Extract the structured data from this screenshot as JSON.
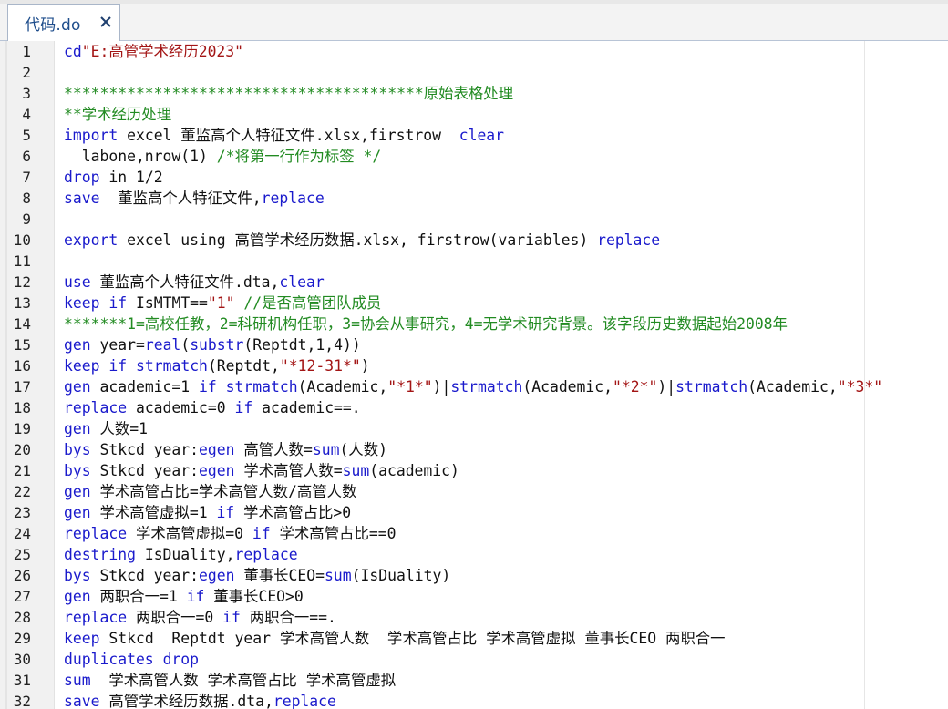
{
  "tab": {
    "title": "代码.do",
    "close_symbol": "×"
  },
  "colors": {
    "keyword": "#1a1acc",
    "string": "#a31515",
    "comment": "#228b22",
    "plain": "#111111",
    "tab_text": "#1f4e8c"
  },
  "lines": [
    {
      "n": "1",
      "tokens": [
        {
          "c": "kw",
          "t": "cd"
        },
        {
          "c": "str",
          "t": "\"E:高管学术经历2023\""
        }
      ]
    },
    {
      "n": "2",
      "tokens": []
    },
    {
      "n": "3",
      "tokens": [
        {
          "c": "cmt",
          "t": "****************************************原始表格处理"
        }
      ]
    },
    {
      "n": "4",
      "tokens": [
        {
          "c": "cmt",
          "t": "**学术经历处理"
        }
      ]
    },
    {
      "n": "5",
      "tokens": [
        {
          "c": "kw",
          "t": "import"
        },
        {
          "c": "plain",
          "t": " excel 董监高个人特征文件.xlsx,firstrow  "
        },
        {
          "c": "kw",
          "t": "clear"
        }
      ]
    },
    {
      "n": "6",
      "tokens": [
        {
          "c": "plain",
          "t": "  labone,nrow(1) "
        },
        {
          "c": "cmt",
          "t": "/*将第一行作为标签 */"
        }
      ]
    },
    {
      "n": "7",
      "tokens": [
        {
          "c": "kw",
          "t": "drop"
        },
        {
          "c": "plain",
          "t": " in 1/2"
        }
      ]
    },
    {
      "n": "8",
      "tokens": [
        {
          "c": "kw",
          "t": "save"
        },
        {
          "c": "plain",
          "t": "  董监高个人特征文件,"
        },
        {
          "c": "kw",
          "t": "replace"
        }
      ]
    },
    {
      "n": "9",
      "tokens": []
    },
    {
      "n": "10",
      "tokens": [
        {
          "c": "kw",
          "t": "export"
        },
        {
          "c": "plain",
          "t": " excel using 高管学术经历数据.xlsx, firstrow(variables) "
        },
        {
          "c": "kw",
          "t": "replace"
        }
      ]
    },
    {
      "n": "11",
      "tokens": []
    },
    {
      "n": "12",
      "tokens": [
        {
          "c": "kw",
          "t": "use"
        },
        {
          "c": "plain",
          "t": " 董监高个人特征文件.dta,"
        },
        {
          "c": "kw",
          "t": "clear"
        }
      ]
    },
    {
      "n": "13",
      "tokens": [
        {
          "c": "kw",
          "t": "keep"
        },
        {
          "c": "plain",
          "t": " "
        },
        {
          "c": "kw",
          "t": "if"
        },
        {
          "c": "plain",
          "t": " IsMTMT=="
        },
        {
          "c": "str",
          "t": "\"1\""
        },
        {
          "c": "plain",
          "t": " "
        },
        {
          "c": "cmt",
          "t": "//是否高管团队成员"
        }
      ]
    },
    {
      "n": "14",
      "tokens": [
        {
          "c": "cmt",
          "t": "*******1=高校任教，2=科研机构任职，3=协会从事研究，4=无学术研究背景。该字段历史数据起始2008年"
        }
      ]
    },
    {
      "n": "15",
      "tokens": [
        {
          "c": "kw",
          "t": "gen"
        },
        {
          "c": "plain",
          "t": " year="
        },
        {
          "c": "kw",
          "t": "real"
        },
        {
          "c": "plain",
          "t": "("
        },
        {
          "c": "kw",
          "t": "substr"
        },
        {
          "c": "plain",
          "t": "(Reptdt,1,4))"
        }
      ]
    },
    {
      "n": "16",
      "tokens": [
        {
          "c": "kw",
          "t": "keep"
        },
        {
          "c": "plain",
          "t": " "
        },
        {
          "c": "kw",
          "t": "if"
        },
        {
          "c": "plain",
          "t": " "
        },
        {
          "c": "kw",
          "t": "strmatch"
        },
        {
          "c": "plain",
          "t": "(Reptdt,"
        },
        {
          "c": "str",
          "t": "\"*12-31*\""
        },
        {
          "c": "plain",
          "t": ")"
        }
      ]
    },
    {
      "n": "17",
      "tokens": [
        {
          "c": "kw",
          "t": "gen"
        },
        {
          "c": "plain",
          "t": " academic=1 "
        },
        {
          "c": "kw",
          "t": "if"
        },
        {
          "c": "plain",
          "t": " "
        },
        {
          "c": "kw",
          "t": "strmatch"
        },
        {
          "c": "plain",
          "t": "(Academic,"
        },
        {
          "c": "str",
          "t": "\"*1*\""
        },
        {
          "c": "plain",
          "t": ")|"
        },
        {
          "c": "kw",
          "t": "strmatch"
        },
        {
          "c": "plain",
          "t": "(Academic,"
        },
        {
          "c": "str",
          "t": "\"*2*\""
        },
        {
          "c": "plain",
          "t": ")|"
        },
        {
          "c": "kw",
          "t": "strmatch"
        },
        {
          "c": "plain",
          "t": "(Academic,"
        },
        {
          "c": "str",
          "t": "\"*3*\""
        }
      ]
    },
    {
      "n": "18",
      "tokens": [
        {
          "c": "kw",
          "t": "replace"
        },
        {
          "c": "plain",
          "t": " academic=0 "
        },
        {
          "c": "kw",
          "t": "if"
        },
        {
          "c": "plain",
          "t": " academic==."
        }
      ]
    },
    {
      "n": "19",
      "tokens": [
        {
          "c": "kw",
          "t": "gen"
        },
        {
          "c": "plain",
          "t": " 人数=1"
        }
      ]
    },
    {
      "n": "20",
      "tokens": [
        {
          "c": "kw",
          "t": "bys"
        },
        {
          "c": "plain",
          "t": " Stkcd year:"
        },
        {
          "c": "kw",
          "t": "egen"
        },
        {
          "c": "plain",
          "t": " 高管人数="
        },
        {
          "c": "kw",
          "t": "sum"
        },
        {
          "c": "plain",
          "t": "(人数)"
        }
      ]
    },
    {
      "n": "21",
      "tokens": [
        {
          "c": "kw",
          "t": "bys"
        },
        {
          "c": "plain",
          "t": " Stkcd year:"
        },
        {
          "c": "kw",
          "t": "egen"
        },
        {
          "c": "plain",
          "t": " 学术高管人数="
        },
        {
          "c": "kw",
          "t": "sum"
        },
        {
          "c": "plain",
          "t": "(academic)"
        }
      ]
    },
    {
      "n": "22",
      "tokens": [
        {
          "c": "kw",
          "t": "gen"
        },
        {
          "c": "plain",
          "t": " 学术高管占比=学术高管人数/高管人数"
        }
      ]
    },
    {
      "n": "23",
      "tokens": [
        {
          "c": "kw",
          "t": "gen"
        },
        {
          "c": "plain",
          "t": " 学术高管虚拟=1 "
        },
        {
          "c": "kw",
          "t": "if"
        },
        {
          "c": "plain",
          "t": " 学术高管占比>0"
        }
      ]
    },
    {
      "n": "24",
      "tokens": [
        {
          "c": "kw",
          "t": "replace"
        },
        {
          "c": "plain",
          "t": " 学术高管虚拟=0 "
        },
        {
          "c": "kw",
          "t": "if"
        },
        {
          "c": "plain",
          "t": " 学术高管占比==0"
        }
      ]
    },
    {
      "n": "25",
      "tokens": [
        {
          "c": "kw",
          "t": "destring"
        },
        {
          "c": "plain",
          "t": " IsDuality,"
        },
        {
          "c": "kw",
          "t": "replace"
        }
      ]
    },
    {
      "n": "26",
      "tokens": [
        {
          "c": "kw",
          "t": "bys"
        },
        {
          "c": "plain",
          "t": " Stkcd year:"
        },
        {
          "c": "kw",
          "t": "egen"
        },
        {
          "c": "plain",
          "t": " 董事长CEO="
        },
        {
          "c": "kw",
          "t": "sum"
        },
        {
          "c": "plain",
          "t": "(IsDuality)"
        }
      ]
    },
    {
      "n": "27",
      "tokens": [
        {
          "c": "kw",
          "t": "gen"
        },
        {
          "c": "plain",
          "t": " 两职合一=1 "
        },
        {
          "c": "kw",
          "t": "if"
        },
        {
          "c": "plain",
          "t": " 董事长CEO>0"
        }
      ]
    },
    {
      "n": "28",
      "tokens": [
        {
          "c": "kw",
          "t": "replace"
        },
        {
          "c": "plain",
          "t": " 两职合一=0 "
        },
        {
          "c": "kw",
          "t": "if"
        },
        {
          "c": "plain",
          "t": " 两职合一==."
        }
      ]
    },
    {
      "n": "29",
      "tokens": [
        {
          "c": "kw",
          "t": "keep"
        },
        {
          "c": "plain",
          "t": " Stkcd  Reptdt year 学术高管人数  学术高管占比 学术高管虚拟 董事长CEO 两职合一"
        }
      ]
    },
    {
      "n": "30",
      "tokens": [
        {
          "c": "kw",
          "t": "duplicates"
        },
        {
          "c": "plain",
          "t": " "
        },
        {
          "c": "kw",
          "t": "drop"
        }
      ]
    },
    {
      "n": "31",
      "tokens": [
        {
          "c": "kw",
          "t": "sum"
        },
        {
          "c": "plain",
          "t": "  学术高管人数 学术高管占比 学术高管虚拟"
        }
      ]
    },
    {
      "n": "32",
      "tokens": [
        {
          "c": "kw",
          "t": "save"
        },
        {
          "c": "plain",
          "t": " 高管学术经历数据.dta,"
        },
        {
          "c": "kw",
          "t": "replace"
        }
      ]
    }
  ]
}
